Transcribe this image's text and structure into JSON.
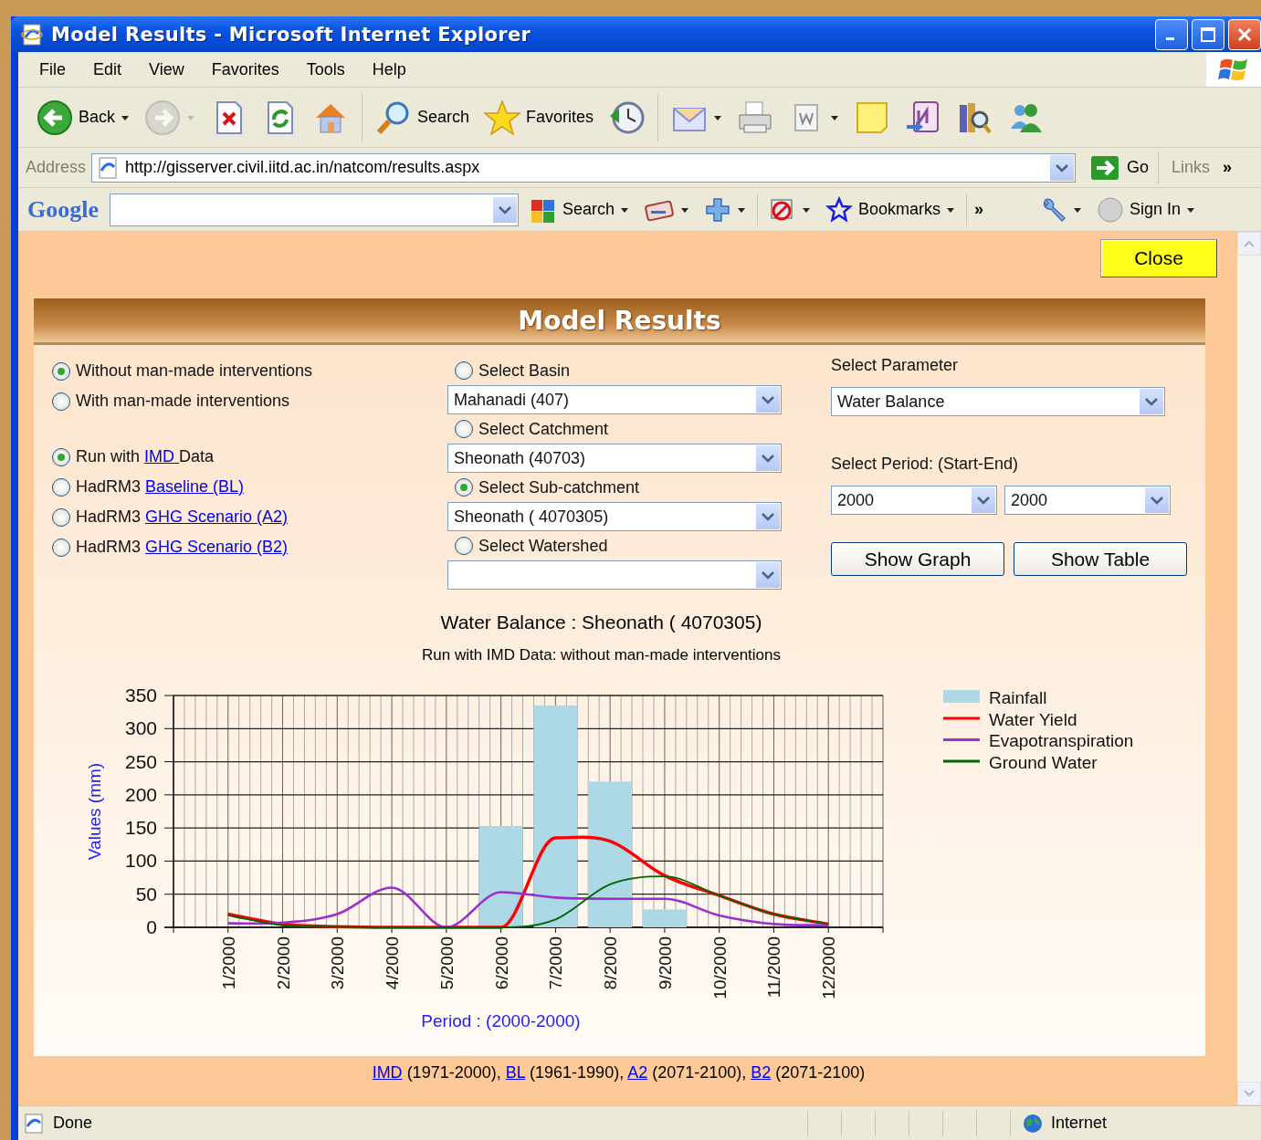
{
  "window": {
    "title": "Model Results - Microsoft Internet Explorer"
  },
  "menu": [
    "File",
    "Edit",
    "View",
    "Favorites",
    "Tools",
    "Help"
  ],
  "toolbar": [
    {
      "kind": "back",
      "label": "Back",
      "dropdown": true
    },
    {
      "kind": "forward",
      "dropdown": true,
      "disabled": true
    },
    {
      "kind": "stop"
    },
    {
      "kind": "refresh"
    },
    {
      "kind": "home"
    },
    {
      "kind": "separator"
    },
    {
      "kind": "search",
      "label": "Search"
    },
    {
      "kind": "favorites",
      "label": "Favorites"
    },
    {
      "kind": "history"
    },
    {
      "kind": "separator"
    },
    {
      "kind": "mail",
      "dropdown": true
    },
    {
      "kind": "print"
    },
    {
      "kind": "word",
      "dropdown": true
    },
    {
      "kind": "note"
    },
    {
      "kind": "onenote"
    },
    {
      "kind": "research"
    },
    {
      "kind": "messenger"
    }
  ],
  "address_bar": {
    "label": "Address",
    "url": "http://gisserver.civil.iitd.ac.in/natcom/results.aspx",
    "go": "Go",
    "links": "Links",
    "more": "»"
  },
  "google_bar": {
    "logo": "Google",
    "search": "Search",
    "bookmarks": "Bookmarks",
    "more": "»",
    "sign_in": "Sign In"
  },
  "page": {
    "close": "Close",
    "title": "Model Results",
    "interventions": [
      {
        "label": "Without man-made interventions",
        "selected": true
      },
      {
        "label": "With man-made interventions",
        "selected": false
      }
    ],
    "data_sources": [
      {
        "prefix": "Run with ",
        "link": "IMD ",
        "suffix": "Data",
        "selected": true
      },
      {
        "prefix": "HadRM3 ",
        "link": "Baseline (BL)",
        "selected": false
      },
      {
        "prefix": "HadRM3 ",
        "link": "GHG Scenario (A2)",
        "selected": false
      },
      {
        "prefix": "HadRM3 ",
        "link": "GHG Scenario (B2)",
        "selected": false
      }
    ],
    "regions": [
      {
        "label": "Select Basin",
        "selected": false,
        "value": "Mahanadi (407)"
      },
      {
        "label": "Select Catchment",
        "selected": false,
        "value": "Sheonath (40703)"
      },
      {
        "label": "Select Sub-catchment",
        "selected": true,
        "value": "Sheonath ( 4070305)"
      },
      {
        "label": "Select Watershed",
        "selected": false
      }
    ],
    "parameter": {
      "label": "Select Parameter",
      "value": "Water Balance"
    },
    "period": {
      "label": "Select Period: (Start-End)",
      "start": "2000",
      "end": "2000"
    },
    "buttons": [
      "Show Graph",
      "Show Table"
    ],
    "chart_subtitle": "Run with IMD Data: without man-made interventions",
    "chart_data": {
      "type": "bar",
      "title": "Water Balance : Sheonath ( 4070305)",
      "xlabel": "Period : (2000-2000)",
      "ylabel": "Values (mm)",
      "categories": [
        "1/2000",
        "2/2000",
        "3/2000",
        "4/2000",
        "5/2000",
        "6/2000",
        "7/2000",
        "8/2000",
        "9/2000",
        "10/2000",
        "11/2000",
        "12/2000"
      ],
      "series": [
        {
          "name": "Rainfall",
          "color": "#add8e6",
          "values": [
            0,
            0,
            0,
            0,
            0,
            153,
            335,
            220,
            27,
            0,
            0,
            0
          ]
        },
        {
          "name": "Water Yield",
          "type": "line",
          "color": "#ff0000",
          "values": [
            20,
            5,
            1,
            0,
            0,
            0,
            135,
            130,
            78,
            48,
            20,
            5
          ]
        },
        {
          "name": "Evapotranspiration",
          "type": "line",
          "color": "#9932cc",
          "values": [
            6,
            7,
            20,
            60,
            0,
            53,
            45,
            43,
            43,
            18,
            5,
            3
          ]
        },
        {
          "name": "Ground Water",
          "type": "line",
          "color": "#006400",
          "values": [
            18,
            3,
            1,
            0,
            0,
            0,
            12,
            65,
            77,
            48,
            20,
            5
          ]
        }
      ],
      "grid": true,
      "legend": true,
      "ylim": [
        0,
        350
      ],
      "yticks": [
        0,
        50,
        100,
        150,
        200,
        250,
        300,
        350
      ]
    },
    "footnotes": [
      {
        "link": "IMD",
        "text": " (1971-2000), "
      },
      {
        "link": "BL",
        "text": " (1961-1990), "
      },
      {
        "link": "A2",
        "text": " (2071-2100), "
      },
      {
        "link": "B2",
        "text": " (2071-2100)"
      }
    ]
  },
  "status_bar": {
    "text": "Done",
    "zone": "Internet"
  }
}
